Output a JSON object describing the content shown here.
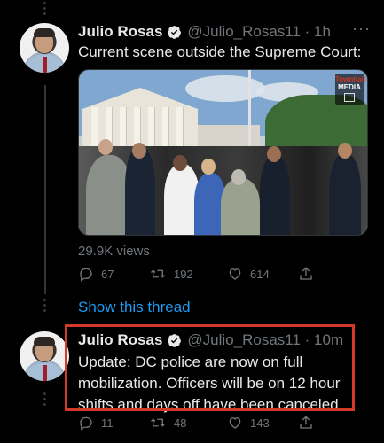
{
  "tweet1": {
    "name": "Julio Rosas",
    "handle": "@Julio_Rosas11 · 1h",
    "text": "Current scene outside the Supreme Court:",
    "media_brand_line1": "Townhall",
    "media_brand_line2": "MEDIA",
    "views": "29.9K views",
    "reply_count": "67",
    "retweet_count": "192",
    "like_count": "614",
    "more_icon": "more-horizontal-icon"
  },
  "show_thread_label": "Show this thread",
  "tweet2": {
    "name": "Julio Rosas",
    "handle": "@Julio_Rosas11 · 10m",
    "text": "Update: DC police are now on full mobilization. Officers will be on 12 hour shifts and days off have been canceled.",
    "reply_count": "11",
    "retweet_count": "48",
    "like_count": "143"
  },
  "colors": {
    "background": "#000000",
    "text": "#e7e9ea",
    "muted": "#71767b",
    "link": "#1d9bf0",
    "verified": "#1d9bf0",
    "highlight": "#d43a25"
  }
}
